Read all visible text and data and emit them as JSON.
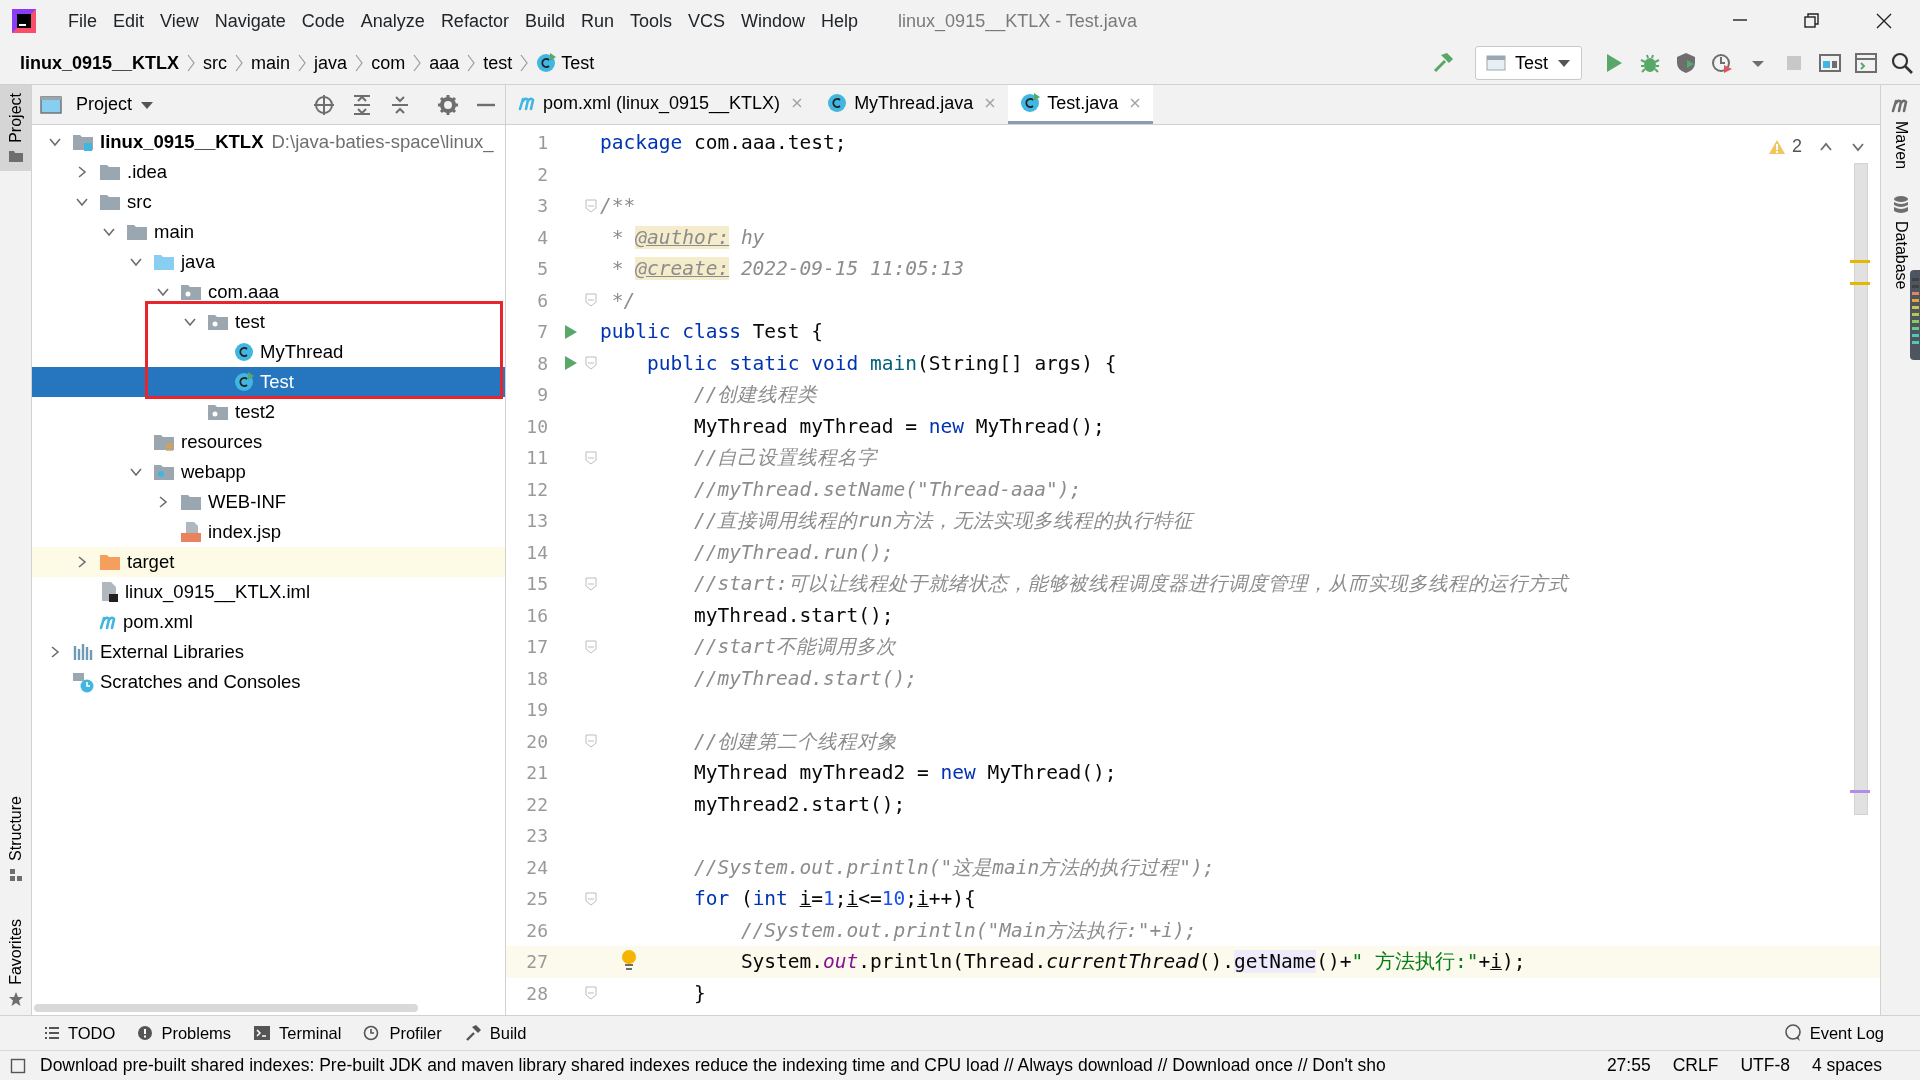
{
  "menu_bar": {
    "items": [
      "File",
      "Edit",
      "View",
      "Navigate",
      "Code",
      "Analyze",
      "Refactor",
      "Build",
      "Run",
      "Tools",
      "VCS",
      "Window",
      "Help"
    ],
    "title": "linux_0915__KTLX - Test.java"
  },
  "navigation_bar": {
    "breadcrumbs": [
      {
        "label": "linux_0915__KTLX",
        "kind": "project"
      },
      {
        "label": "src",
        "kind": "folder"
      },
      {
        "label": "main",
        "kind": "folder"
      },
      {
        "label": "java",
        "kind": "folder"
      },
      {
        "label": "com",
        "kind": "folder"
      },
      {
        "label": "aaa",
        "kind": "folder"
      },
      {
        "label": "test",
        "kind": "folder"
      },
      {
        "label": "Test",
        "kind": "class"
      }
    ],
    "run_configuration": "Test"
  },
  "left_stripe": [
    {
      "label": "Project",
      "kind": "project",
      "selected": true
    },
    {
      "label": "Structure",
      "kind": "structure",
      "selected": false
    },
    {
      "label": "Favorites",
      "kind": "favorites",
      "selected": false
    }
  ],
  "project_panel": {
    "title": "Project",
    "tree": [
      {
        "label": "linux_0915__KTLX",
        "kind": "module",
        "note": "D:\\java-baties-space\\linux_",
        "expanded": true,
        "selected": false,
        "children": [
          {
            "label": ".idea",
            "kind": "folder",
            "expanded": false,
            "selected": false
          },
          {
            "label": "src",
            "kind": "folder",
            "expanded": true,
            "selected": false,
            "children": [
              {
                "label": "main",
                "kind": "folder",
                "expanded": true,
                "selected": false,
                "children": [
                  {
                    "label": "java",
                    "kind": "source-root",
                    "expanded": true,
                    "selected": false,
                    "children": [
                      {
                        "label": "com.aaa",
                        "kind": "package",
                        "expanded": true,
                        "selected": false,
                        "children": [
                          {
                            "label": "test",
                            "kind": "package",
                            "expanded": true,
                            "selected": false,
                            "framed": true,
                            "children": [
                              {
                                "label": "MyThread",
                                "kind": "class",
                                "selected": false
                              },
                              {
                                "label": "Test",
                                "kind": "runnable-class",
                                "selected": true
                              }
                            ]
                          },
                          {
                            "label": "test2",
                            "kind": "package",
                            "selected": false
                          }
                        ]
                      }
                    ]
                  },
                  {
                    "label": "resources",
                    "kind": "resources",
                    "selected": false
                  },
                  {
                    "label": "webapp",
                    "kind": "web-root",
                    "expanded": true,
                    "selected": false,
                    "children": [
                      {
                        "label": "WEB-INF",
                        "kind": "folder",
                        "expanded": false,
                        "selected": false
                      },
                      {
                        "label": "index.jsp",
                        "kind": "jsp",
                        "selected": false
                      }
                    ]
                  }
                ]
              }
            ]
          },
          {
            "label": "target",
            "kind": "excluded",
            "expanded": false,
            "selected": false
          },
          {
            "label": "linux_0915__KTLX.iml",
            "kind": "iml",
            "selected": false
          },
          {
            "label": "pom.xml",
            "kind": "maven",
            "selected": false
          }
        ]
      },
      {
        "label": "External Libraries",
        "kind": "libraries",
        "expanded": false,
        "selected": false
      },
      {
        "label": "Scratches and Consoles",
        "kind": "scratches",
        "selected": false
      }
    ]
  },
  "editor": {
    "tabs": [
      {
        "label": "pom.xml (linux_0915__KTLX)",
        "kind": "maven",
        "selected": false
      },
      {
        "label": "MyThread.java",
        "kind": "class",
        "selected": false
      },
      {
        "label": "Test.java",
        "kind": "runnable-class",
        "selected": true
      }
    ],
    "warnings": "2",
    "lines": [
      {
        "number": "1",
        "kind": "top",
        "segments": [
          {
            "kind": "keyword",
            "text": "package"
          },
          {
            "kind": "plain",
            "text": " com.aaa.test;"
          }
        ]
      },
      {
        "number": "2"
      },
      {
        "number": "3",
        "kind": "top",
        "fold": true,
        "segments": [
          {
            "kind": "doc",
            "text": "/**"
          }
        ]
      },
      {
        "number": "4",
        "kind": "doc",
        "segments": [
          {
            "kind": "doc",
            "text": "* "
          },
          {
            "kind": "doc-tag",
            "text": "@author:"
          },
          {
            "kind": "doc",
            "text": " hy"
          }
        ]
      },
      {
        "number": "5",
        "kind": "doc",
        "segments": [
          {
            "kind": "doc",
            "text": "* "
          },
          {
            "kind": "doc-tag",
            "text": "@create:"
          },
          {
            "kind": "doc",
            "text": " 2022-09-15 11:05:13"
          }
        ]
      },
      {
        "number": "6",
        "kind": "doc",
        "fold": true,
        "segments": [
          {
            "kind": "doc",
            "text": "*/"
          }
        ]
      },
      {
        "number": "7",
        "kind": "top",
        "run": true,
        "segments": [
          {
            "kind": "keyword",
            "text": "public class"
          },
          {
            "kind": "plain",
            "text": " Test {"
          }
        ]
      },
      {
        "number": "8",
        "kind": "member",
        "run": true,
        "fold": true,
        "segments": [
          {
            "kind": "keyword",
            "text": "public static void "
          },
          {
            "kind": "declaration",
            "text": "main"
          },
          {
            "kind": "plain",
            "text": "(String[] args) {"
          }
        ]
      },
      {
        "number": "9",
        "kind": "body",
        "segments": [
          {
            "kind": "comment",
            "text": "//创建线程类"
          }
        ]
      },
      {
        "number": "10",
        "kind": "body",
        "segments": [
          {
            "kind": "plain",
            "text": "MyThread myThread = "
          },
          {
            "kind": "keyword",
            "text": "new"
          },
          {
            "kind": "plain",
            "text": " MyThread();"
          }
        ]
      },
      {
        "number": "11",
        "kind": "body",
        "fold": true,
        "segments": [
          {
            "kind": "comment",
            "text": "//自己设置线程名字"
          }
        ]
      },
      {
        "number": "12",
        "kind": "body",
        "segments": [
          {
            "kind": "comment",
            "text": "//myThread.setName(\"Thread-aaa\");"
          }
        ]
      },
      {
        "number": "13",
        "kind": "body",
        "segments": [
          {
            "kind": "comment",
            "text": "//直接调用线程的run方法，无法实现多线程的执行特征"
          }
        ]
      },
      {
        "number": "14",
        "kind": "body",
        "segments": [
          {
            "kind": "comment",
            "text": "//myThread.run();"
          }
        ]
      },
      {
        "number": "15",
        "kind": "body",
        "fold": true,
        "segments": [
          {
            "kind": "comment",
            "text": "//start:可以让线程处于就绪状态，能够被线程调度器进行调度管理，从而实现多线程的运行方式"
          }
        ]
      },
      {
        "number": "16",
        "kind": "body",
        "segments": [
          {
            "kind": "plain",
            "text": "myThread.start();"
          }
        ]
      },
      {
        "number": "17",
        "kind": "body",
        "fold": true,
        "segments": [
          {
            "kind": "comment",
            "text": "//start不能调用多次"
          }
        ]
      },
      {
        "number": "18",
        "kind": "body",
        "segments": [
          {
            "kind": "comment",
            "text": "//myThread.start();"
          }
        ]
      },
      {
        "number": "19"
      },
      {
        "number": "20",
        "kind": "body",
        "fold": true,
        "segments": [
          {
            "kind": "comment",
            "text": "//创建第二个线程对象"
          }
        ]
      },
      {
        "number": "21",
        "kind": "body",
        "segments": [
          {
            "kind": "plain",
            "text": "MyThread myThread2 = "
          },
          {
            "kind": "keyword",
            "text": "new"
          },
          {
            "kind": "plain",
            "text": " MyThread();"
          }
        ]
      },
      {
        "number": "22",
        "kind": "body",
        "segments": [
          {
            "kind": "plain",
            "text": "myThread2.start();"
          }
        ]
      },
      {
        "number": "23"
      },
      {
        "number": "24",
        "kind": "body",
        "segments": [
          {
            "kind": "comment",
            "text": "//System.out.println(\"这是main方法的执行过程\");"
          }
        ]
      },
      {
        "number": "25",
        "kind": "body",
        "fold": true,
        "segments": [
          {
            "kind": "keyword",
            "text": "for"
          },
          {
            "kind": "plain",
            "text": " ("
          },
          {
            "kind": "keyword",
            "text": "int "
          },
          {
            "kind": "variable",
            "text": "i"
          },
          {
            "kind": "plain",
            "text": "="
          },
          {
            "kind": "number",
            "text": "1"
          },
          {
            "kind": "plain",
            "text": ";"
          },
          {
            "kind": "variable",
            "text": "i"
          },
          {
            "kind": "plain",
            "text": "<="
          },
          {
            "kind": "number",
            "text": "10"
          },
          {
            "kind": "plain",
            "text": ";"
          },
          {
            "kind": "variable",
            "text": "i"
          },
          {
            "kind": "plain",
            "text": "++){"
          }
        ]
      },
      {
        "number": "26",
        "kind": "loop-body",
        "segments": [
          {
            "kind": "comment",
            "text": "//System.out.println(\"Main方法执行:\"+i);"
          }
        ]
      },
      {
        "number": "27",
        "kind": "loop-body",
        "current": true,
        "bulb": true,
        "segments": [
          {
            "kind": "plain",
            "text": "System."
          },
          {
            "kind": "field",
            "text": "out"
          },
          {
            "kind": "plain",
            "text": ".println(Thread."
          },
          {
            "kind": "static-call",
            "text": "currentThread"
          },
          {
            "kind": "plain",
            "text": "()."
          },
          {
            "kind": "usage",
            "text": "getName"
          },
          {
            "kind": "plain",
            "text": "()+"
          },
          {
            "kind": "string",
            "text": "\" 方法执行:\""
          },
          {
            "kind": "plain",
            "text": "+"
          },
          {
            "kind": "variable",
            "text": "i"
          },
          {
            "kind": "plain",
            "text": ");"
          }
        ]
      },
      {
        "number": "28",
        "kind": "body",
        "fold": true,
        "segments": [
          {
            "kind": "plain",
            "text": "}"
          }
        ]
      }
    ]
  },
  "right_stripe": [
    {
      "label": "Maven",
      "kind": "maven"
    },
    {
      "label": "Database",
      "kind": "database"
    }
  ],
  "tool_windows": [
    {
      "label": "TODO",
      "kind": "todo"
    },
    {
      "label": "Problems",
      "kind": "problems"
    },
    {
      "label": "Terminal",
      "kind": "terminal"
    },
    {
      "label": "Profiler",
      "kind": "profiler"
    },
    {
      "label": "Build",
      "kind": "build"
    }
  ],
  "event_log": "Event Log",
  "status_bar": {
    "message": "Download pre-built shared indexes: Pre-built JDK and maven library shared indexes reduce the indexing time and CPU load // Always download // Download once // Don't sho",
    "position": "27:55",
    "line_separator": "CRLF",
    "encoding": "UTF-8",
    "indent": "4 spaces"
  }
}
